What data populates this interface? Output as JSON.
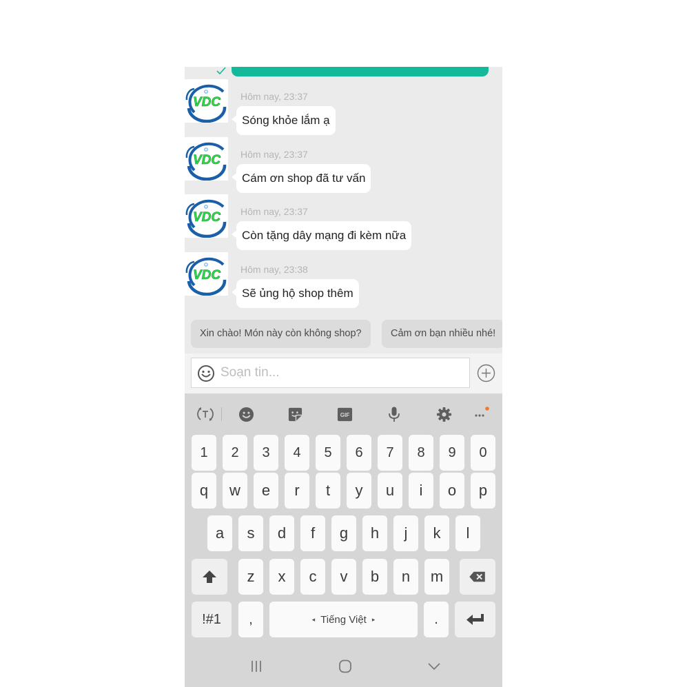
{
  "chat": {
    "sent_message_status": "delivered",
    "messages": [
      {
        "avatar": "VDC",
        "time": "Hôm nay, 23:37",
        "text": "Sóng khỏe lắm ạ"
      },
      {
        "avatar": "VDC",
        "time": "Hôm nay, 23:37",
        "text": "Cám ơn shop đã tư vấn"
      },
      {
        "avatar": "VDC",
        "time": "Hôm nay, 23:37",
        "text": "Còn tặng dây mạng đi kèm nữa"
      },
      {
        "avatar": "VDC",
        "time": "Hôm nay, 23:38",
        "text": "Sẽ ủng hộ shop thêm"
      }
    ]
  },
  "quick_replies": [
    "Xin chào! Món này còn không shop?",
    "Cảm ơn bạn nhiều nhé!"
  ],
  "composer": {
    "placeholder": "Soạn tin...",
    "value": "",
    "emoji_icon": "smiley-icon",
    "attach_icon": "plus-circle-icon"
  },
  "keyboard": {
    "toolbar": [
      "text-translate-icon",
      "emoji-icon",
      "sticker-icon",
      "gif-icon",
      "microphone-icon",
      "settings-icon",
      "more-icon"
    ],
    "gif_label": "GIF",
    "rows": {
      "numbers": [
        "1",
        "2",
        "3",
        "4",
        "5",
        "6",
        "7",
        "8",
        "9",
        "0"
      ],
      "row1": [
        "q",
        "w",
        "e",
        "r",
        "t",
        "y",
        "u",
        "i",
        "o",
        "p"
      ],
      "row2": [
        "a",
        "s",
        "d",
        "f",
        "g",
        "h",
        "j",
        "k",
        "l"
      ],
      "row3": [
        "z",
        "x",
        "c",
        "v",
        "b",
        "n",
        "m"
      ]
    },
    "symbols_label": "!#1",
    "comma": ",",
    "period": ".",
    "space_label": "Tiếng Việt",
    "space_left_arrow": "◂",
    "space_right_arrow": "▸"
  },
  "colors": {
    "accent": "#14b89a",
    "notification_dot": "#f07a2a",
    "logo_green": "#2ee04a",
    "logo_blue": "#1a5fa8"
  }
}
